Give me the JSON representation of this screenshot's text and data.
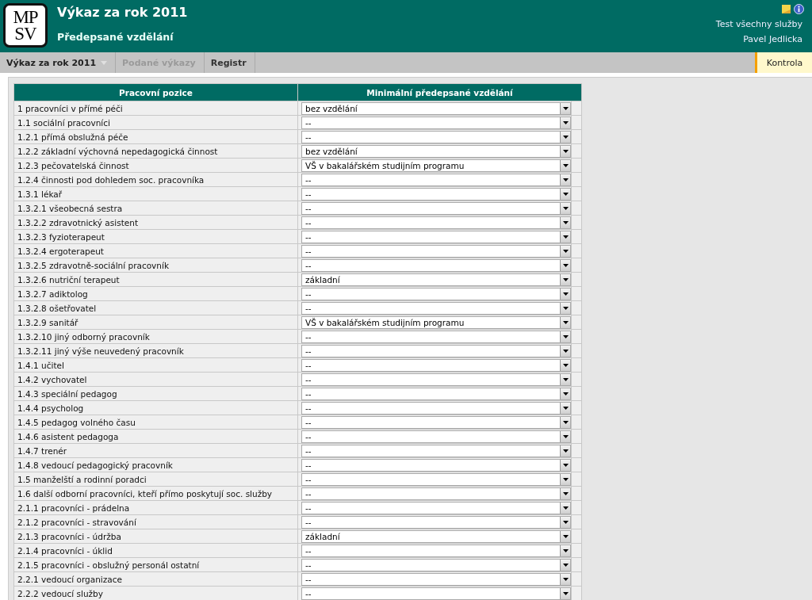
{
  "header": {
    "logo": {
      "line1": "MP",
      "line2": "SV"
    },
    "title": "Výkaz za rok 2011",
    "subtitle": "Předepsané vzdělání",
    "service": "Test všechny služby",
    "user": "Pavel Jedlicka"
  },
  "nav": {
    "items": [
      {
        "label": "Výkaz za rok 2011",
        "selected": true,
        "disabled": false,
        "has_menu": true
      },
      {
        "label": "Podané výkazy",
        "selected": false,
        "disabled": true,
        "has_menu": false
      },
      {
        "label": "Registr",
        "selected": false,
        "disabled": false,
        "has_menu": false
      }
    ],
    "right_button": "Kontrola"
  },
  "table": {
    "columns": [
      "Pracovní pozice",
      "Minimální předepsané vzdělání"
    ],
    "rows": [
      {
        "position": "1 pracovníci v přímé péči",
        "education": "bez vzdělání"
      },
      {
        "position": "1.1 sociální pracovníci",
        "education": "--"
      },
      {
        "position": "1.2.1 přímá obslužná péče",
        "education": "--"
      },
      {
        "position": "1.2.2 základní výchovná nepedagogická činnost",
        "education": "bez vzdělání"
      },
      {
        "position": "1.2.3 pečovatelská činnost",
        "education": "VŠ v bakalářském studijním programu"
      },
      {
        "position": "1.2.4 činnosti pod dohledem soc. pracovníka",
        "education": "--"
      },
      {
        "position": "1.3.1 lékař",
        "education": "--"
      },
      {
        "position": "1.3.2.1 všeobecná sestra",
        "education": "--"
      },
      {
        "position": "1.3.2.2 zdravotnický asistent",
        "education": "--"
      },
      {
        "position": "1.3.2.3 fyzioterapeut",
        "education": "--"
      },
      {
        "position": "1.3.2.4 ergoterapeut",
        "education": "--"
      },
      {
        "position": "1.3.2.5 zdravotně-sociální pracovník",
        "education": "--"
      },
      {
        "position": "1.3.2.6 nutriční terapeut",
        "education": "základní"
      },
      {
        "position": "1.3.2.7 adiktolog",
        "education": "--"
      },
      {
        "position": "1.3.2.8 ošetřovatel",
        "education": "--"
      },
      {
        "position": "1.3.2.9 sanitář",
        "education": "VŠ v bakalářském studijním programu"
      },
      {
        "position": "1.3.2.10 jiný odborný pracovník",
        "education": "--"
      },
      {
        "position": "1.3.2.11 jiný výše neuvedený pracovník",
        "education": "--"
      },
      {
        "position": "1.4.1 učitel",
        "education": "--"
      },
      {
        "position": "1.4.2 vychovatel",
        "education": "--"
      },
      {
        "position": "1.4.3 speciální pedagog",
        "education": "--"
      },
      {
        "position": "1.4.4 psycholog",
        "education": "--"
      },
      {
        "position": "1.4.5 pedagog volného času",
        "education": "--"
      },
      {
        "position": "1.4.6 asistent pedagoga",
        "education": "--"
      },
      {
        "position": "1.4.7 trenér",
        "education": "--"
      },
      {
        "position": "1.4.8 vedoucí pedagogický pracovník",
        "education": "--"
      },
      {
        "position": "1.5 manželští a rodinní poradci",
        "education": "--"
      },
      {
        "position": "1.6 další odborní pracovníci, kteří přímo poskytují soc. služby",
        "education": "--"
      },
      {
        "position": "2.1.1 pracovníci - prádelna",
        "education": "--"
      },
      {
        "position": "2.1.2 pracovníci - stravování",
        "education": "--"
      },
      {
        "position": "2.1.3 pracovníci - údržba",
        "education": "základní"
      },
      {
        "position": "2.1.4 pracovníci - úklid",
        "education": "--"
      },
      {
        "position": "2.1.5 pracovníci - obslužný personál ostatní",
        "education": "--"
      },
      {
        "position": "2.2.1 vedoucí organizace",
        "education": "--"
      },
      {
        "position": "2.2.2 vedoucí služby",
        "education": "--"
      }
    ]
  }
}
